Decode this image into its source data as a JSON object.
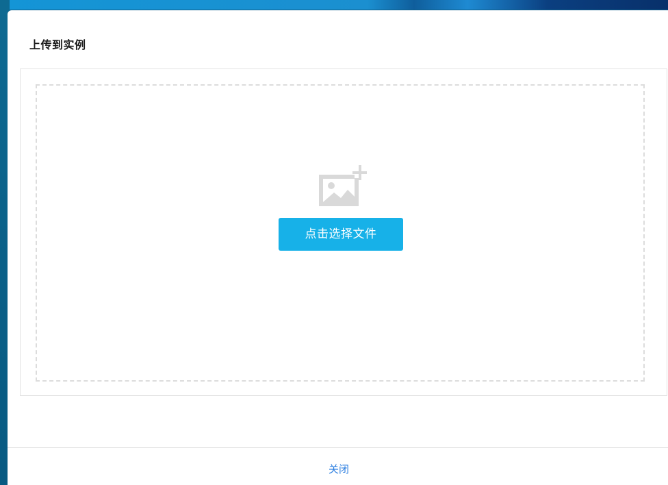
{
  "dialog": {
    "title": "上传到实例",
    "upload": {
      "icon": "image-add-icon",
      "button_label": "点击选择文件"
    },
    "footer": {
      "close_label": "关闭"
    }
  },
  "colors": {
    "accent": "#17b1e8",
    "link": "#2d7fe0",
    "dashed_border": "#dcdcdc",
    "icon": "#d8d8d8"
  }
}
